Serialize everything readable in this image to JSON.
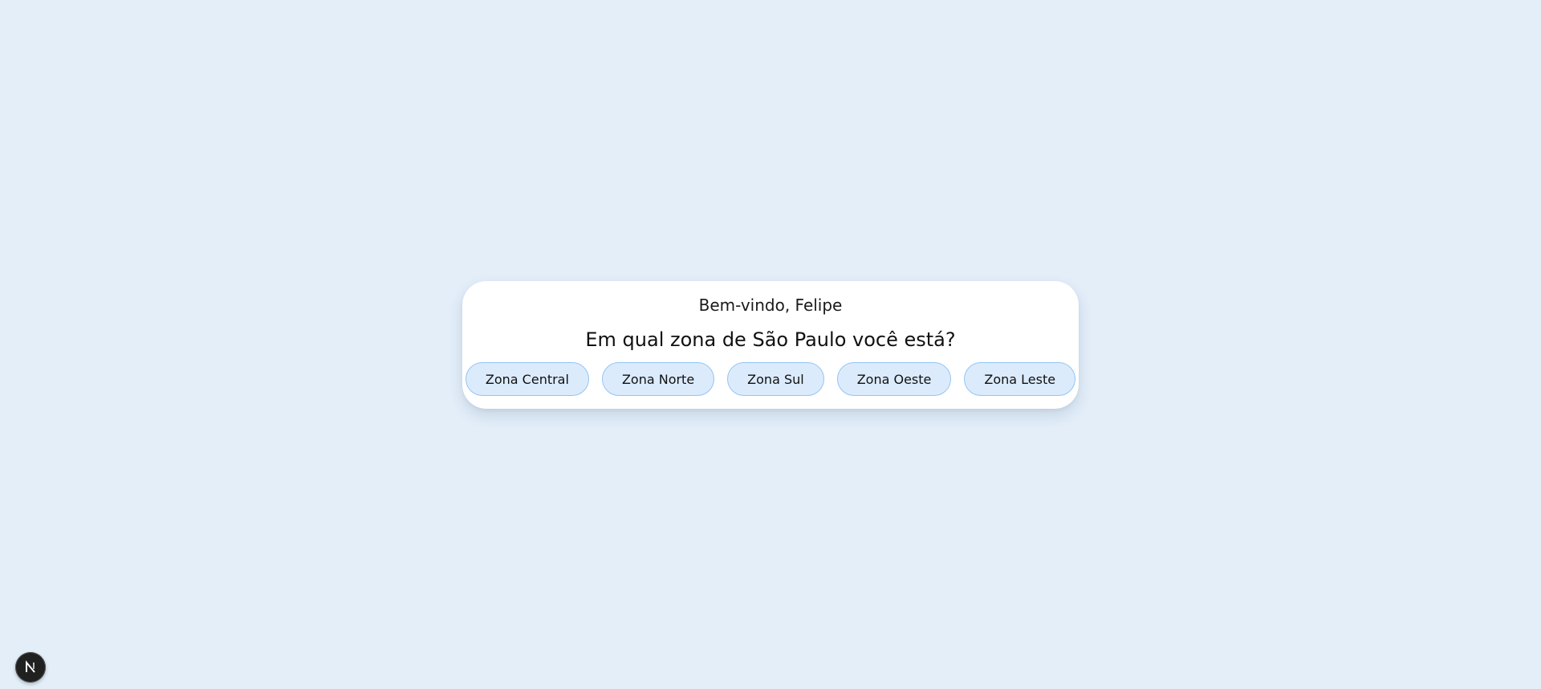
{
  "card": {
    "welcome": "Bem-vindo, Felipe",
    "question": "Em qual zona de São Paulo você está?",
    "zones": [
      {
        "label": "Zona Central"
      },
      {
        "label": "Zona Norte"
      },
      {
        "label": "Zona Sul"
      },
      {
        "label": "Zona Oeste"
      },
      {
        "label": "Zona Leste"
      }
    ]
  },
  "dev_indicator": {
    "icon": "nextjs-logo-icon"
  },
  "colors": {
    "background": "#e3eef9",
    "card": "#ffffff",
    "button_fill": "#dcebfc",
    "button_border": "#93c5f5"
  }
}
